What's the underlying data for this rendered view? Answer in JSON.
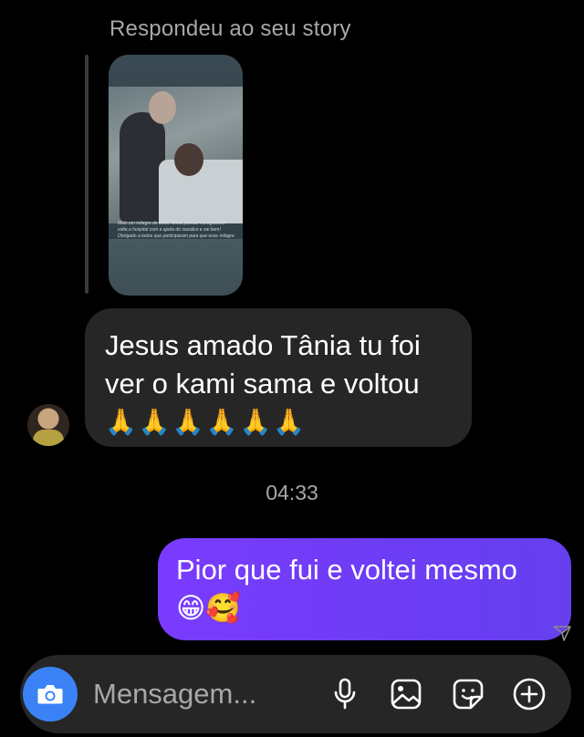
{
  "reply_context": {
    "label": "Respondeu ao seu story",
    "story_caption": "Mais um milagre de Deus nessa parada #amigadona volta a hospital com a ajuda do socialco e sai bem! Obrigado a todos que participaram para que esse milagre acontecesse 🙏"
  },
  "messages": [
    {
      "direction": "incoming",
      "lines": [
        "Jesus amado Tânia tu foi",
        "ver o kami sama e voltou"
      ],
      "emoji_line": "🙏🙏🙏🙏🙏🙏"
    },
    {
      "direction": "outgoing",
      "lines": [
        "Pior que fui e voltei mesmo"
      ],
      "emoji_line": "😁🥰"
    }
  ],
  "timestamp": "04:33",
  "composer": {
    "placeholder": "Mensagem...",
    "value": ""
  },
  "icons": {
    "camera": "camera-icon",
    "mic": "microphone-icon",
    "gallery": "image-icon",
    "sticker": "sticker-icon",
    "add": "plus-circle-icon",
    "seen": "seen-icon"
  },
  "colors": {
    "background": "#000000",
    "incoming_bubble": "#262626",
    "outgoing_bubble_start": "#7a3bff",
    "outgoing_bubble_end": "#6640ef",
    "camera_button": "#3b82f6",
    "secondary_text": "#a8a8a8"
  }
}
